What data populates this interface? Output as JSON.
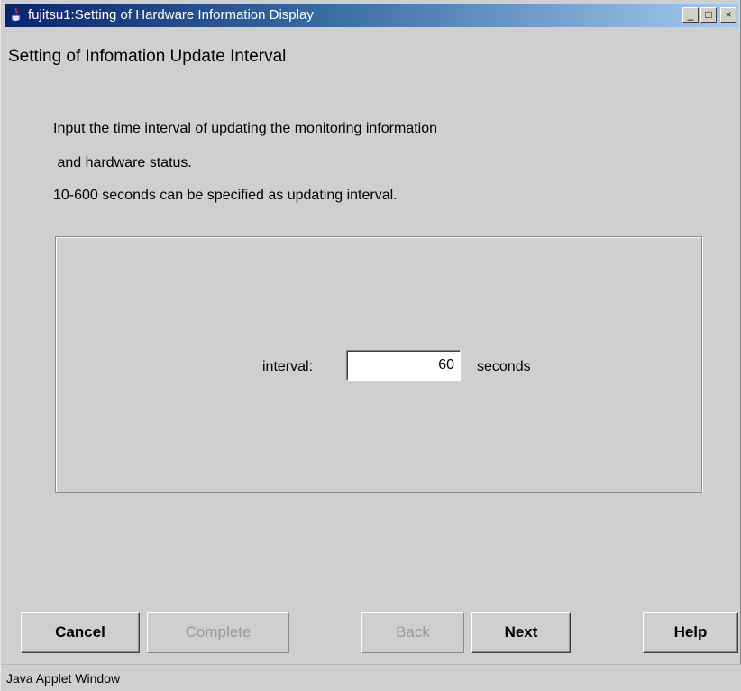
{
  "window": {
    "title": "fujitsu1:Setting of Hardware Information Display",
    "title_icon": "java-cup-icon",
    "controls": {
      "minimize": "_",
      "maximize": "□",
      "close": "×"
    }
  },
  "heading": "Setting of Infomation Update Interval",
  "description": {
    "line1": "Input the time interval of updating the monitoring information",
    "line2": " and hardware status.",
    "line3": "10-600 seconds can be specified as updating interval."
  },
  "interval": {
    "label": "interval:",
    "value": "60",
    "unit": "seconds"
  },
  "buttons": {
    "cancel": "Cancel",
    "complete": "Complete",
    "back": "Back",
    "next": "Next",
    "help": "Help"
  },
  "status_bar": "Java Applet Window",
  "colors": {
    "window_bg": "#cfcfcf",
    "titlebar_start": "#0a246a",
    "titlebar_end": "#a6caf0",
    "disabled_text": "#9a9a9a"
  }
}
